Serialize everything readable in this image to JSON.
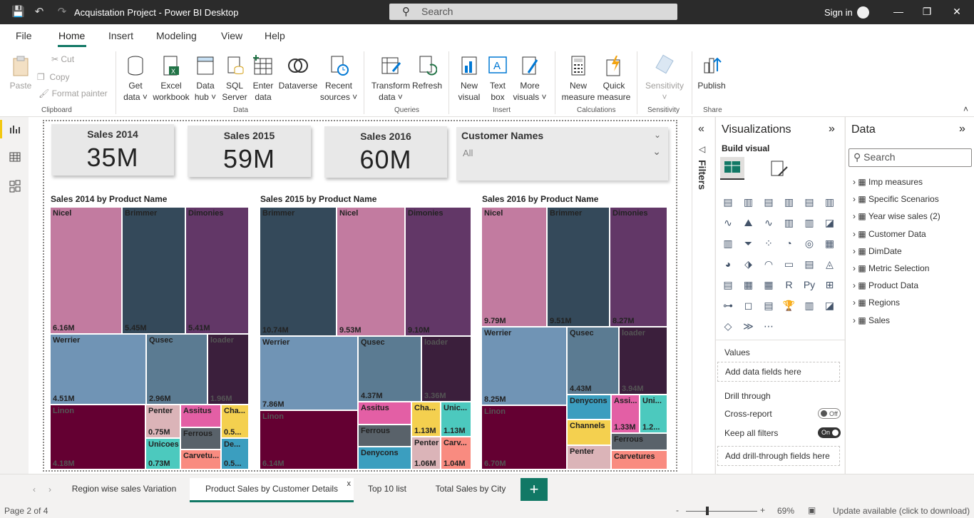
{
  "app": {
    "title": "Acquistation Project - Power BI Desktop",
    "search_placeholder": "Search",
    "signin": "Sign in"
  },
  "menu": {
    "file": "File",
    "home": "Home",
    "insert": "Insert",
    "modeling": "Modeling",
    "view": "View",
    "help": "Help"
  },
  "ribbon": {
    "paste": "Paste",
    "cut": "Cut",
    "copy": "Copy",
    "format_painter": "Format painter",
    "clipboard": "Clipboard",
    "get_data_1": "Get",
    "get_data_2": "data",
    "excel_1": "Excel",
    "excel_2": "workbook",
    "datahub_1": "Data",
    "datahub_2": "hub",
    "sql_1": "SQL",
    "sql_2": "Server",
    "enter_1": "Enter",
    "enter_2": "data",
    "dataverse": "Dataverse",
    "recent_1": "Recent",
    "recent_2": "sources",
    "data_group": "Data",
    "transform_1": "Transform",
    "transform_2": "data",
    "refresh": "Refresh",
    "queries_group": "Queries",
    "newvisual_1": "New",
    "newvisual_2": "visual",
    "textbox_1": "Text",
    "textbox_2": "box",
    "more_1": "More",
    "more_2": "visuals",
    "insert_group": "Insert",
    "newmeasure_1": "New",
    "newmeasure_2": "measure",
    "quick_1": "Quick",
    "quick_2": "measure",
    "calc_group": "Calculations",
    "sensitivity": "Sensitivity",
    "sens_group": "Sensitivity",
    "publish": "Publish",
    "share_group": "Share"
  },
  "cards": [
    {
      "title": "Sales 2014",
      "value": "35M"
    },
    {
      "title": "Sales 2015",
      "value": "59M"
    },
    {
      "title": "Sales 2016",
      "value": "60M"
    }
  ],
  "slicer": {
    "title": "Customer Names",
    "value": "All"
  },
  "treemaps": {
    "t2014": {
      "title": "Sales 2014 by Product Name"
    },
    "t2015": {
      "title": "Sales 2015 by Product Name"
    },
    "t2016": {
      "title": "Sales 2016 by Product Name"
    }
  },
  "tiles_2014": [
    {
      "name": "Nicel",
      "value": "6.16M"
    },
    {
      "name": "Brimmer",
      "value": "5.45M"
    },
    {
      "name": "Dimonies",
      "value": "5.41M"
    },
    {
      "name": "Werrier",
      "value": "4.51M"
    },
    {
      "name": "Qusec",
      "value": "2.96M"
    },
    {
      "name": "loader",
      "value": "1.96M"
    },
    {
      "name": "Linon",
      "value": "4.18M"
    },
    {
      "name": "Penter",
      "value": "0.75M"
    },
    {
      "name": "Assitus",
      "value": ""
    },
    {
      "name": "Cha...",
      "value": "0.5..."
    },
    {
      "name": "Ferrous",
      "value": ""
    },
    {
      "name": "Unicoes",
      "value": "0.73M"
    },
    {
      "name": "Carvetu...",
      "value": ""
    },
    {
      "name": "De...",
      "value": "0.5..."
    }
  ],
  "tiles_2015": [
    {
      "name": "Brimmer",
      "value": "10.74M"
    },
    {
      "name": "Nicel",
      "value": "9.53M"
    },
    {
      "name": "Dimonies",
      "value": "9.10M"
    },
    {
      "name": "Werrier",
      "value": "7.86M"
    },
    {
      "name": "Qusec",
      "value": "4.37M"
    },
    {
      "name": "loader",
      "value": "3.36M"
    },
    {
      "name": "Linon",
      "value": "6.14M"
    },
    {
      "name": "Assitus",
      "value": ""
    },
    {
      "name": "Cha...",
      "value": "1.13M"
    },
    {
      "name": "Unic...",
      "value": "1.13M"
    },
    {
      "name": "Ferrous",
      "value": ""
    },
    {
      "name": "Penter",
      "value": "1.06M"
    },
    {
      "name": "Carv...",
      "value": "1.04M"
    },
    {
      "name": "Denycons",
      "value": ""
    }
  ],
  "tiles_2016": [
    {
      "name": "Nicel",
      "value": "9.79M"
    },
    {
      "name": "Brimmer",
      "value": "9.51M"
    },
    {
      "name": "Dimonies",
      "value": "8.27M"
    },
    {
      "name": "Werrier",
      "value": "8.25M"
    },
    {
      "name": "Qusec",
      "value": "4.43M"
    },
    {
      "name": "loader",
      "value": "3.94M"
    },
    {
      "name": "Linon",
      "value": "6.70M"
    },
    {
      "name": "Denycons",
      "value": ""
    },
    {
      "name": "Assi...",
      "value": "1.33M"
    },
    {
      "name": "Uni...",
      "value": "1.2..."
    },
    {
      "name": "Channels",
      "value": ""
    },
    {
      "name": "Ferrous",
      "value": ""
    },
    {
      "name": "Penter",
      "value": ""
    },
    {
      "name": "Carvetures",
      "value": ""
    }
  ],
  "filters": {
    "label": "Filters"
  },
  "viz": {
    "title": "Visualizations",
    "build": "Build visual",
    "values": "Values",
    "add_fields": "Add data fields here",
    "drill": "Drill through",
    "cross": "Cross-report",
    "cross_state": "Off",
    "keep": "Keep all filters",
    "keep_state": "On",
    "add_drill": "Add drill-through fields here"
  },
  "data_pane": {
    "title": "Data",
    "search": "Search",
    "items": [
      "Imp measures",
      "Specific Scenarios",
      "Year wise sales (2)",
      "Customer Data",
      "DimDate",
      "Metric Selection",
      "Product Data",
      "Regions",
      "Sales"
    ]
  },
  "tabs": [
    "Region wise sales Variation",
    "Product Sales by Customer Details",
    "Top 10 list",
    "Total Sales by City"
  ],
  "status": {
    "page": "Page 2 of 4",
    "zoom": "69%",
    "update": "Update available (click to download)"
  },
  "colors": {
    "accent": "#117865",
    "pink": "#c27ba0",
    "navy": "#34495a",
    "purple": "#623767",
    "steel": "#7094b5",
    "slate": "#5b7b92",
    "plum": "#3b1f3c",
    "maroon": "#640032"
  }
}
